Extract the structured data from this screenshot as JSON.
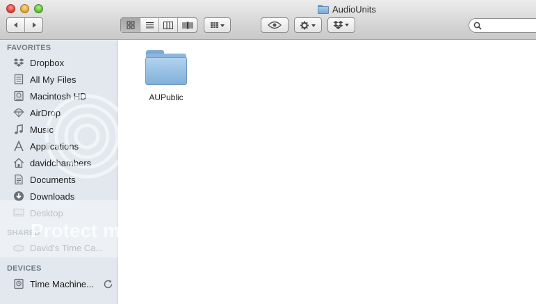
{
  "window": {
    "title": "AudioUnits"
  },
  "toolbar": {
    "back_icon": "chevron-left-icon",
    "forward_icon": "chevron-right-icon",
    "view_modes": [
      "icon-view-icon",
      "list-view-icon",
      "column-view-icon",
      "coverflow-view-icon"
    ],
    "active_view": "icon-view-icon",
    "search": {
      "placeholder": "",
      "value": ""
    }
  },
  "sidebar": {
    "favorites_header": "FAVORITES",
    "favorites": [
      {
        "label": "Dropbox",
        "icon": "dropbox-icon"
      },
      {
        "label": "All My Files",
        "icon": "all-files-icon"
      },
      {
        "label": "Macintosh HD",
        "icon": "hard-drive-icon"
      },
      {
        "label": "AirDrop",
        "icon": "airdrop-icon"
      },
      {
        "label": "Music",
        "icon": "music-icon"
      },
      {
        "label": "Applications",
        "icon": "applications-icon"
      },
      {
        "label": "davidchambers",
        "icon": "home-icon"
      },
      {
        "label": "Documents",
        "icon": "documents-icon"
      },
      {
        "label": "Downloads",
        "icon": "downloads-icon"
      },
      {
        "label": "Desktop",
        "icon": "desktop-icon"
      }
    ],
    "shared_header": "SHARED",
    "shared": [
      {
        "label": "David’s Time Ca...",
        "icon": "network-drive-icon"
      }
    ],
    "devices_header": "DEVICES",
    "devices": [
      {
        "label": "Time Machine...",
        "icon": "time-machine-icon"
      }
    ]
  },
  "main": {
    "items": [
      {
        "label": "AUPublic",
        "icon": "folder-icon"
      }
    ]
  },
  "watermark": {
    "text": "Protect m"
  },
  "colors": {
    "sidebar_bg": "#e3e8ee",
    "section_header": "#6e7a86",
    "folder_blue": "#82b0d9"
  }
}
